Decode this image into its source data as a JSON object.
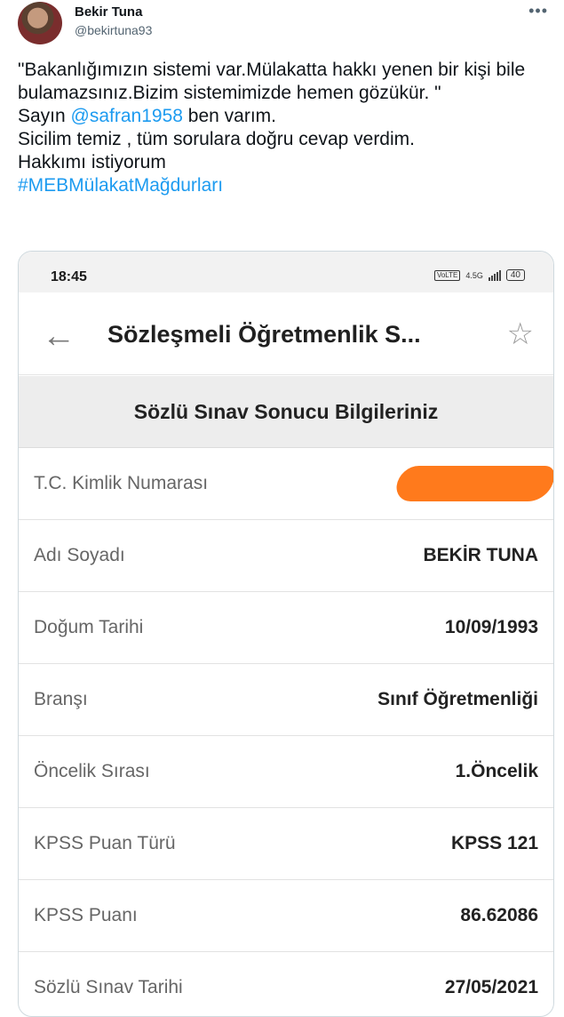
{
  "tweet": {
    "author_name": "Bekir Tuna",
    "author_handle": "@bekirtuna93",
    "more_icon": "more-dots-icon",
    "line1": "\"Bakanlığımızın sistemi var.Mülakatta hakkı yenen bir kişi bile bulamazsınız.Bizim sistemimizde hemen gözükür. \"",
    "line2_prefix": "Sayın ",
    "mention": "@safran1958",
    "line2_suffix": " ben varım.",
    "line3": "Sicilim temiz , tüm sorulara doğru cevap verdim.",
    "line4": "Hakkımı istiyorum",
    "hashtag": "#MEBMülakatMağdurları",
    "link_color": "#1d9bf0"
  },
  "phone": {
    "time": "18:45",
    "network": "4.5G",
    "volte": "VoLTE",
    "battery": "40",
    "app_title": "Sözleşmeli Öğretmenlik S...",
    "back_icon": "back-arrow-icon",
    "star_icon": "star-outline-icon",
    "section_title": "Sözlü Sınav Sonucu Bilgileriniz",
    "redaction_color": "#ff7a1c",
    "rows": [
      {
        "label": "T.C. Kimlik Numarası",
        "value": ""
      },
      {
        "label": "Adı Soyadı",
        "value": "BEKİR TUNA"
      },
      {
        "label": "Doğum Tarihi",
        "value": "10/09/1993"
      },
      {
        "label": "Branşı",
        "value": "Sınıf Öğretmenliği"
      },
      {
        "label": "Öncelik Sırası",
        "value": "1.Öncelik"
      },
      {
        "label": "KPSS Puan Türü",
        "value": "KPSS 121"
      },
      {
        "label": "KPSS Puanı",
        "value": "86.62086"
      },
      {
        "label": "Sözlü Sınav Tarihi",
        "value": "27/05/2021"
      }
    ]
  }
}
